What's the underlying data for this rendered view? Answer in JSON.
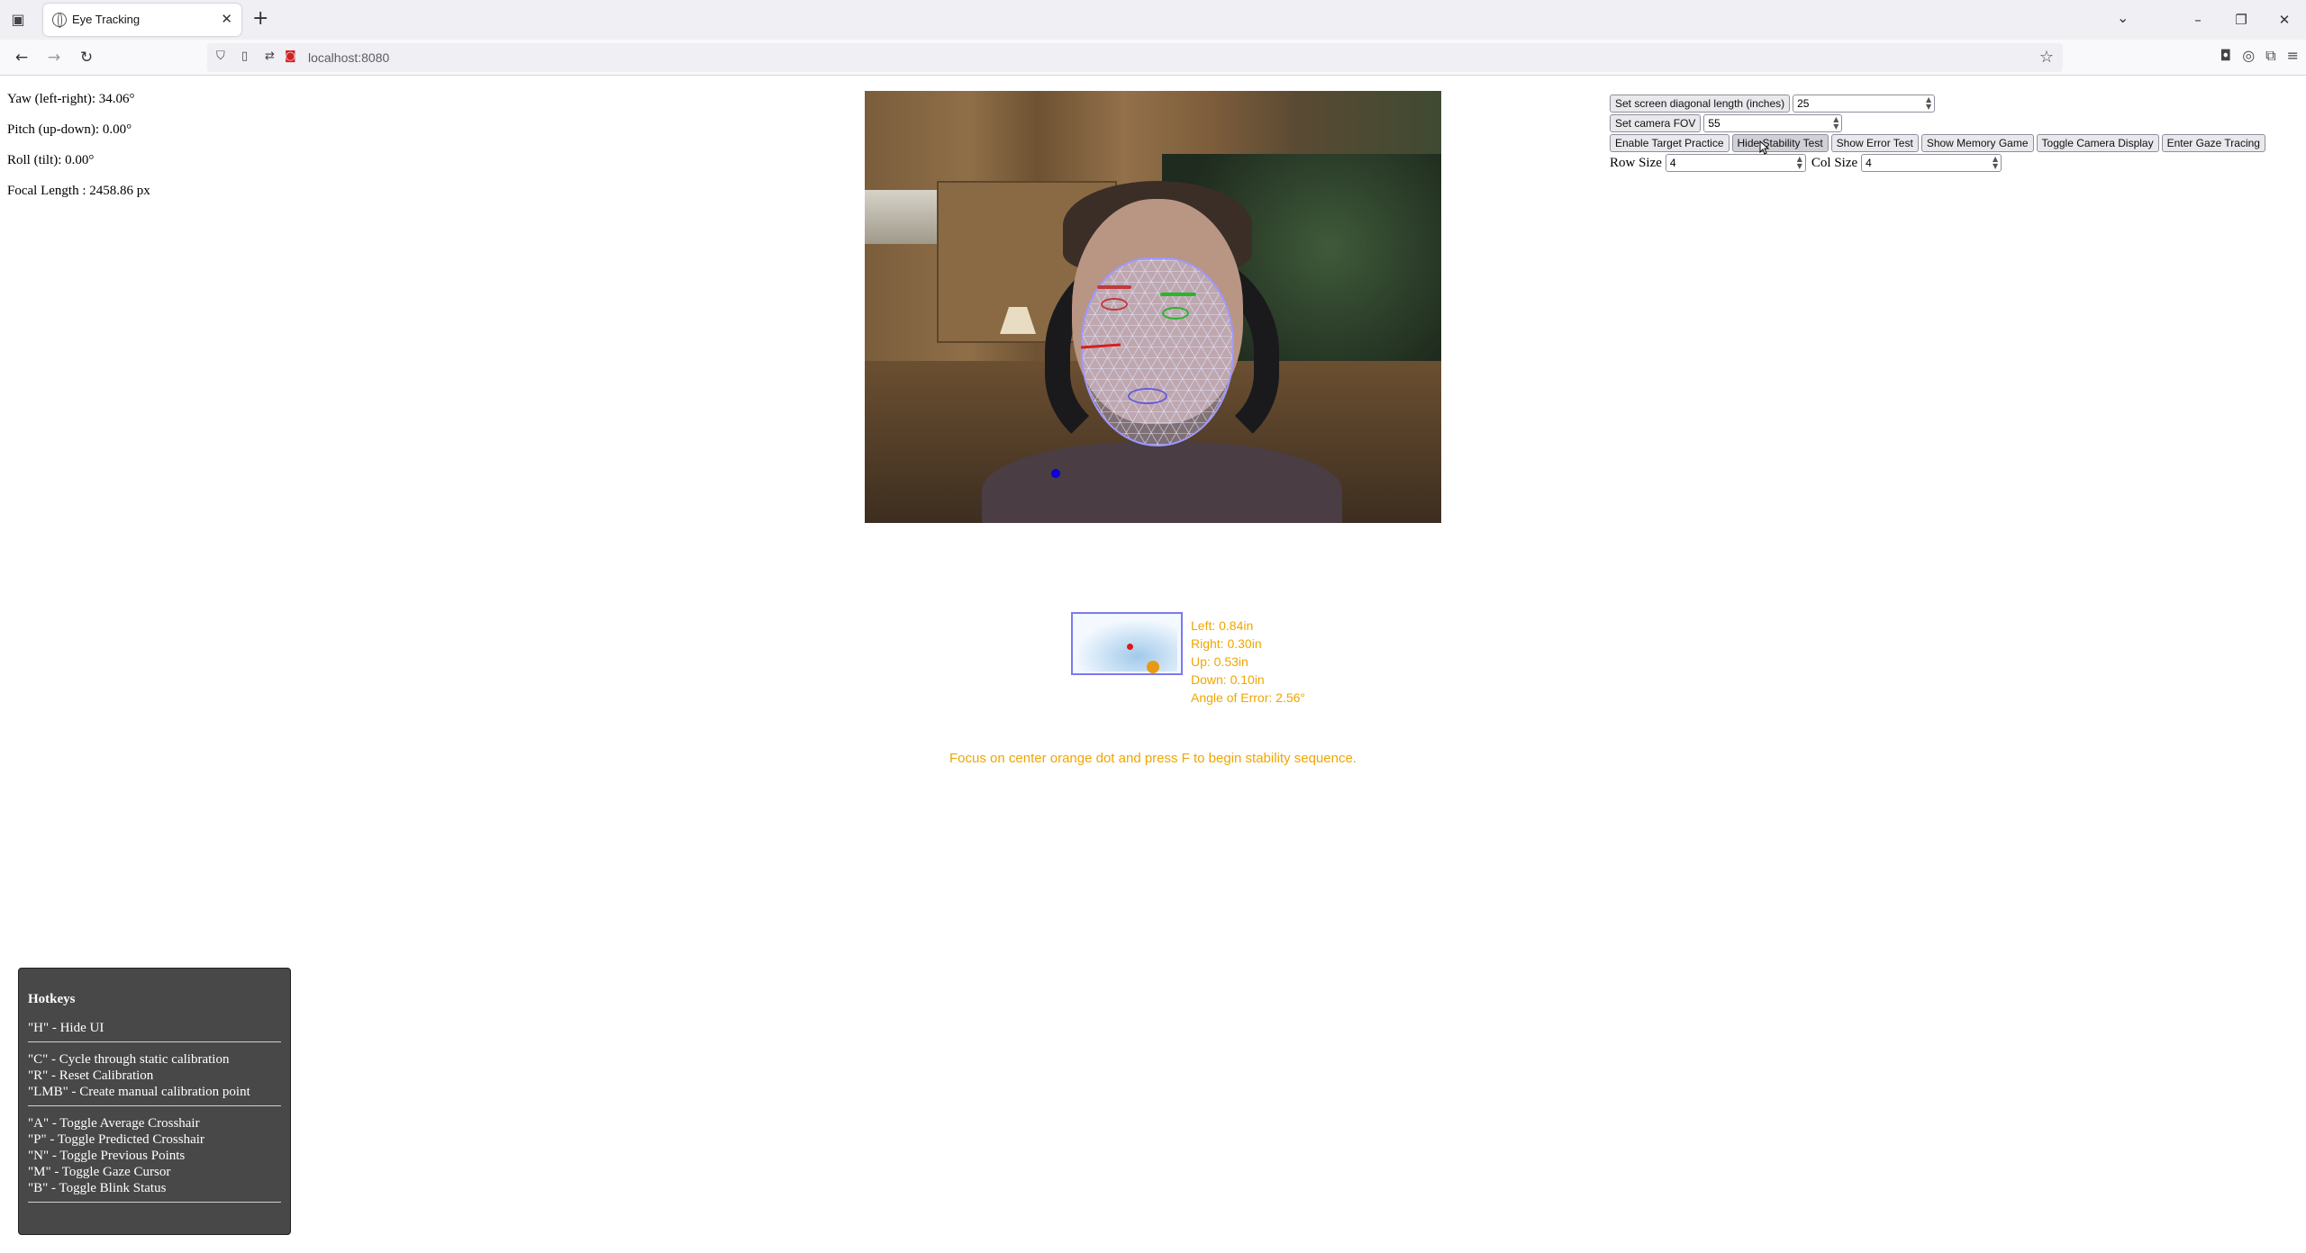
{
  "browser": {
    "tab_title": "Eye Tracking",
    "url": "localhost:8080",
    "icons": {
      "tab_list": "tab-list-icon",
      "new_tab": "plus-icon",
      "tab_close": "close-icon",
      "back": "back-arrow-icon",
      "forward": "forward-arrow-icon",
      "reload": "reload-icon",
      "bookmark": "star-icon"
    }
  },
  "head_pose": {
    "yaw": "Yaw (left-right): 34.06°",
    "pitch": "Pitch (up-down): 0.00°",
    "roll": "Roll (tilt): 0.00°",
    "focal": "Focal Length : 2458.86 px"
  },
  "controls": {
    "screen_diag_label": "Set screen diagonal length (inches)",
    "screen_diag_value": "25",
    "camera_fov_label": "Set camera FOV",
    "camera_fov_value": "55",
    "buttons": [
      "Enable Target Practice",
      "Hide Stability Test",
      "Show Error Test",
      "Show Memory Game",
      "Toggle Camera Display",
      "Enter Gaze Tracing"
    ],
    "row_size_label": "Row Size",
    "row_size_value": "4",
    "col_size_label": "Col Size",
    "col_size_value": "4"
  },
  "error_stats": {
    "left": "Left: 0.84in",
    "right": "Right: 0.30in",
    "up": "Up: 0.53in",
    "down": "Down: 0.10in",
    "angle": "Angle of Error: 2.56°"
  },
  "stability_message": "Focus on center orange dot and press F to begin stability sequence.",
  "hotkeys": {
    "title": "Hotkeys",
    "group1": [
      "\"H\" - Hide UI"
    ],
    "group2": [
      "\"C\" - Cycle through static calibration",
      "\"R\" - Reset Calibration",
      "\"LMB\" - Create manual calibration point"
    ],
    "group3": [
      "\"A\" - Toggle Average Crosshair",
      "\"P\" - Toggle Predicted Crosshair",
      "\"N\" - Toggle Previous Points",
      "\"M\" - Toggle Gaze Cursor",
      "\"B\" - Toggle Blink Status"
    ]
  },
  "colors": {
    "accent_orange": "#f0a500",
    "gaze_dot": "#0a00d8",
    "hotkey_panel": "#484848"
  }
}
